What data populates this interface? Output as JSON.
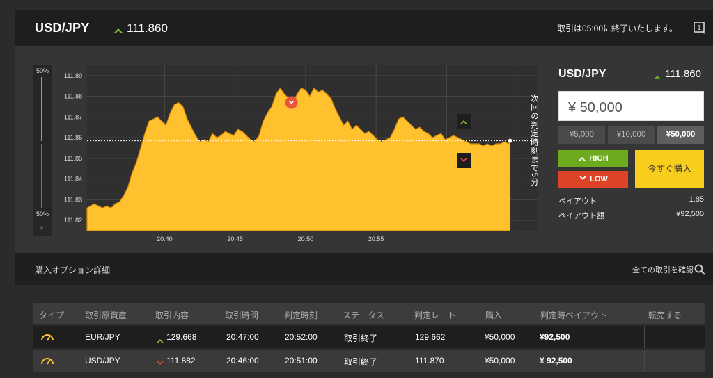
{
  "header": {
    "pair": "USD/JPY",
    "rate": "111.860",
    "notice": "取引は05:00に終了いたします。",
    "expire_icon_label": "1"
  },
  "gauge": {
    "top_label": "50%",
    "bottom_label": "50%",
    "close_label": "×"
  },
  "chart_data": {
    "type": "area",
    "x_ticks": [
      "20:40",
      "20:45",
      "20:50",
      "20:55"
    ],
    "y_ticks": [
      "111.89",
      "111.88",
      "111.87",
      "111.86",
      "111.85",
      "111.84",
      "111.83",
      "111.82"
    ],
    "ylim": [
      111.815,
      111.895
    ],
    "xlim": [
      -1,
      63
    ],
    "strike_rate": 111.8585,
    "current_rate": 111.8585,
    "current_x": 59,
    "entry_marker": {
      "x": 28,
      "y": 111.877,
      "direction": "low"
    },
    "x": [
      -1,
      0.0,
      0.6,
      1.2,
      1.8,
      2.4,
      3.0,
      3.6,
      4.2,
      4.8,
      5.4,
      6.0,
      6.6,
      7.2,
      7.8,
      8.4,
      9.0,
      9.6,
      10.2,
      10.8,
      11.4,
      12.0,
      12.6,
      13.2,
      13.8,
      14.4,
      15.0,
      15.6,
      16.2,
      16.8,
      17.4,
      18.0,
      18.6,
      19.2,
      19.8,
      20.4,
      21.0,
      21.6,
      22.2,
      22.8,
      23.4,
      24.0,
      24.6,
      25.2,
      25.8,
      26.4,
      27.0,
      27.6,
      28.2,
      28.8,
      29.4,
      30.0,
      30.6,
      31.2,
      31.8,
      32.4,
      33.0,
      33.6,
      34.2,
      34.8,
      35.4,
      36.0,
      36.6,
      37.2,
      37.8,
      38.4,
      39.0,
      39.6,
      40.2,
      40.8,
      41.4,
      42.0,
      42.6,
      43.2,
      43.8,
      44.4,
      45.0,
      45.6,
      46.2,
      46.8,
      47.4,
      48.0,
      48.6,
      49.2,
      49.8,
      50.4,
      51.0,
      51.6,
      52.2,
      52.8,
      53.4,
      54.0,
      54.6,
      55.2,
      55.8,
      56.4,
      57.0,
      57.6,
      58.2,
      58.8,
      59.0
    ],
    "y": [
      111.826,
      111.828,
      111.827,
      111.826,
      111.827,
      111.826,
      111.828,
      111.829,
      111.832,
      111.836,
      111.843,
      111.848,
      111.855,
      111.862,
      111.868,
      111.869,
      111.87,
      111.868,
      111.866,
      111.872,
      111.876,
      111.877,
      111.875,
      111.869,
      111.865,
      111.861,
      111.858,
      111.859,
      111.858,
      111.862,
      111.86,
      111.861,
      111.863,
      111.862,
      111.861,
      111.864,
      111.863,
      111.861,
      111.859,
      111.858,
      111.861,
      111.868,
      111.872,
      111.875,
      111.881,
      111.884,
      111.881,
      111.879,
      111.877,
      111.881,
      111.884,
      111.883,
      111.88,
      111.884,
      111.882,
      111.883,
      111.881,
      111.879,
      111.874,
      111.87,
      111.866,
      111.868,
      111.864,
      111.866,
      111.864,
      111.862,
      111.863,
      111.861,
      111.859,
      111.858,
      111.859,
      111.86,
      111.864,
      111.869,
      111.87,
      111.868,
      111.866,
      111.864,
      111.865,
      111.863,
      111.862,
      111.86,
      111.861,
      111.862,
      111.859,
      111.86,
      111.861,
      111.86,
      111.859,
      111.858,
      111.857,
      111.857,
      111.857,
      111.856,
      111.857,
      111.856,
      111.857,
      111.857,
      111.858,
      111.857,
      111.8585
    ]
  },
  "chart_side_label": "次回の判定時刻まで5分",
  "trade": {
    "pair": "USD/JPY",
    "rate": "111.860",
    "amount": "¥ 50,000",
    "presets": [
      "¥5,000",
      "¥10,000",
      "¥50,000"
    ],
    "high_label": "HIGH",
    "low_label": "LOW",
    "buy_label": "今すぐ購入",
    "payout_label": "ペイアウト",
    "payout_value": "1.85",
    "payout_amount_label": "ペイアウト額",
    "payout_amount_value": "¥92,500"
  },
  "details": {
    "title": "購入オプション詳細",
    "view_all": "全ての取引を確認",
    "headers": [
      "タイプ",
      "取引原資産",
      "取引内容",
      "取引時間",
      "判定時刻",
      "ステータス",
      "判定レート",
      "購入",
      "判定時ペイアウト",
      "転売する"
    ],
    "rows": [
      {
        "asset": "EUR/JPY",
        "direction": "high",
        "rate": "129.668",
        "time": "20:47:00",
        "judge": "20:52:00",
        "status": "取引終了",
        "judge_rate": "129.662",
        "purchase": "¥50,000",
        "payout": "¥92,500"
      },
      {
        "asset": "USD/JPY",
        "direction": "low",
        "rate": "111.882",
        "time": "20:46:00",
        "judge": "20:51:00",
        "status": "取引終了",
        "judge_rate": "111.870",
        "purchase": "¥50,000",
        "payout": "¥ 92,500"
      }
    ]
  },
  "colors": {
    "high": "#6cab1d",
    "low": "#dd4326",
    "accent": "#f8cd1c",
    "area": "#ffc12e"
  }
}
